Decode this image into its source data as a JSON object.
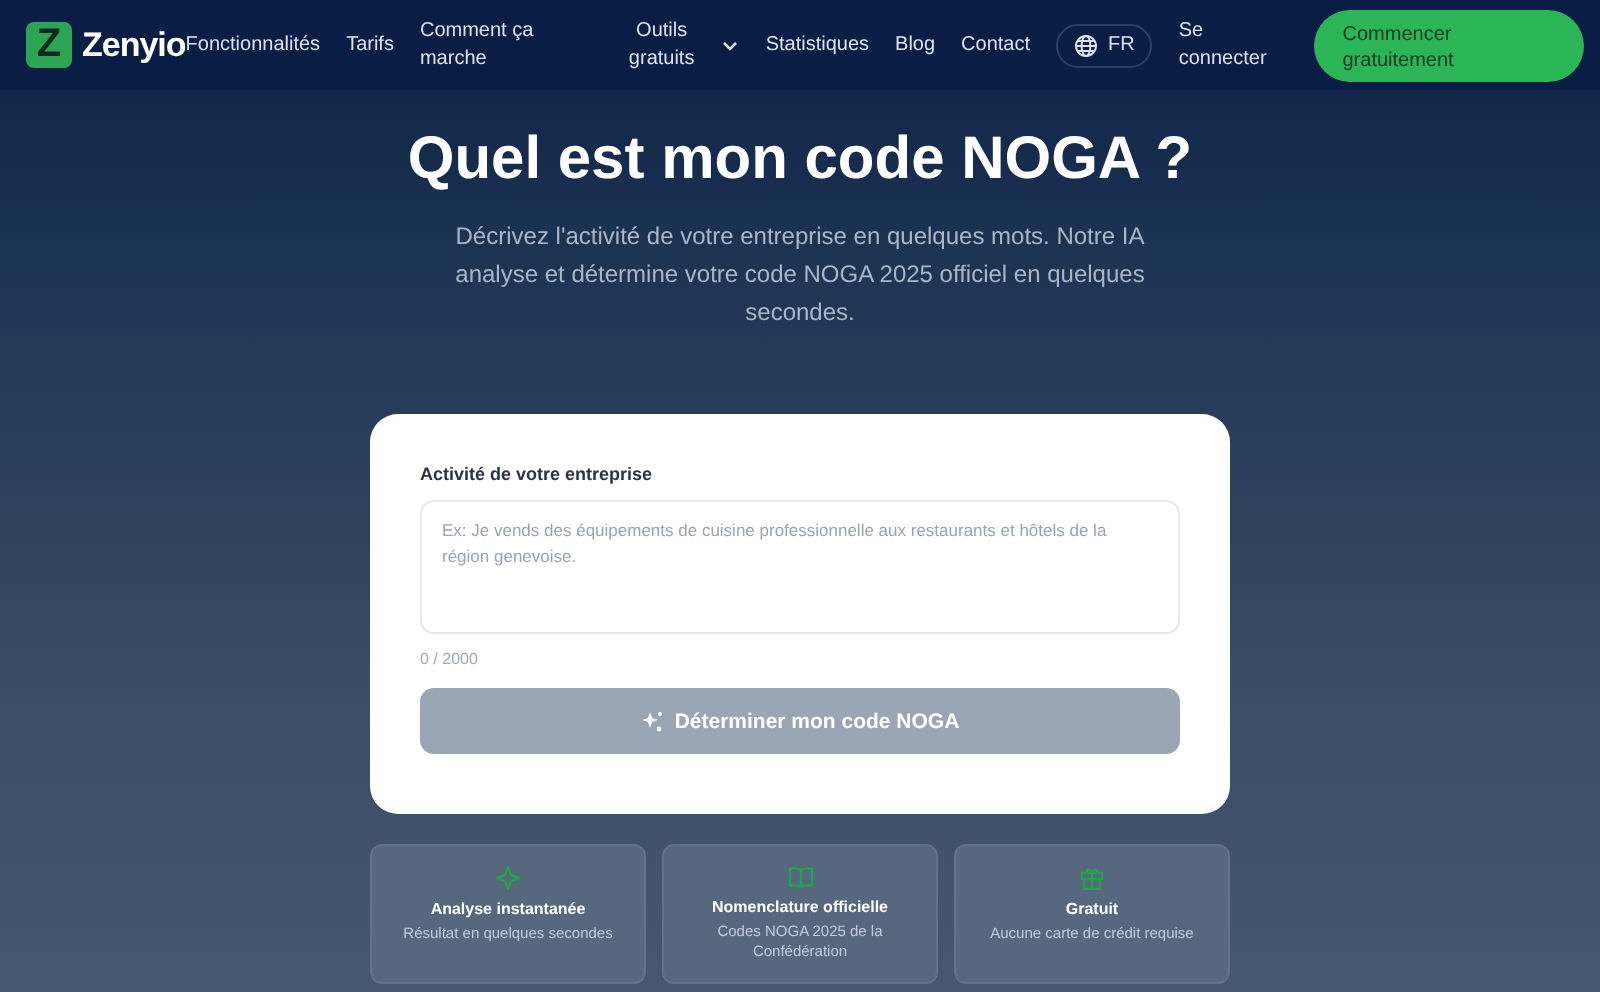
{
  "header": {
    "logo_letter": "Z",
    "brand": "Zenyio",
    "nav": [
      {
        "label": "Fonctionnalités",
        "kind": "link"
      },
      {
        "label": "Tarifs",
        "kind": "link"
      },
      {
        "label": "Comment ça marche",
        "kind": "link"
      },
      {
        "label": "Outils gratuits",
        "kind": "dropdown"
      },
      {
        "label": "Statistiques",
        "kind": "link"
      },
      {
        "label": "Blog",
        "kind": "link"
      },
      {
        "label": "Contact",
        "kind": "link"
      }
    ],
    "language": "FR",
    "login": "Se connecter",
    "cta": "Commencer gratuitement"
  },
  "hero": {
    "title": "Quel est mon code NOGA ?",
    "subtitle": "Décrivez l'activité de votre entreprise en quelques mots. Notre IA analyse et détermine votre code NOGA 2025 officiel en quelques secondes."
  },
  "form": {
    "label": "Activité de votre entreprise",
    "placeholder": "Ex: Je vends des équipements de cuisine professionnelle aux restaurants et hôtels de la région genevoise.",
    "counter": "0 / 2000",
    "submit": {
      "label": "Déterminer mon code NOGA",
      "disabled": true
    }
  },
  "features": [
    {
      "title": "Analyse instantanée",
      "text": "Résultat en quelques secondes"
    },
    {
      "title": "Nomenclature officielle",
      "text": "Codes NOGA 2025 de la Confédération"
    },
    {
      "title": "Gratuit",
      "text": "Aucune carte de crédit requise"
    }
  ]
}
